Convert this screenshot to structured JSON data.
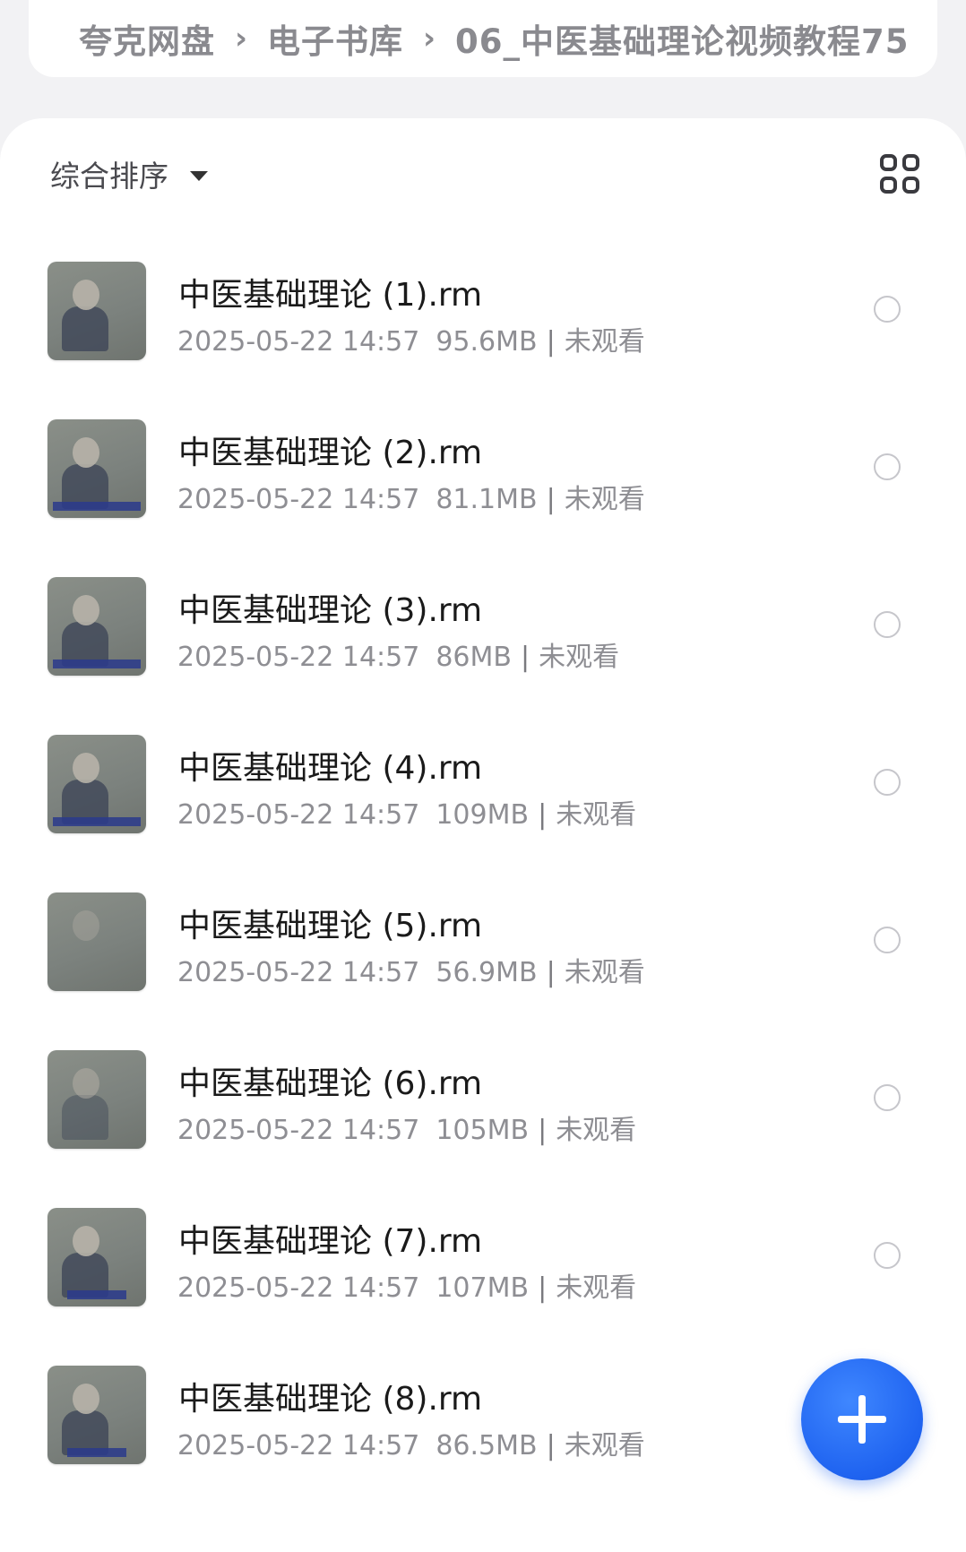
{
  "breadcrumb": {
    "items": [
      "夸克网盘",
      "电子书库",
      "06_中医基础理论视频教程75"
    ],
    "separator": "›"
  },
  "toolbar": {
    "sort_label": "综合排序",
    "sort_icon": "caret-down-icon",
    "view_toggle_icon": "grid-view-icon"
  },
  "files": [
    {
      "name": "中医基础理论 (1).rm",
      "date": "2025-05-22 14:57",
      "size": "95.6MB",
      "sep": "|",
      "status": "未观看"
    },
    {
      "name": "中医基础理论 (2).rm",
      "date": "2025-05-22 14:57",
      "size": "81.1MB",
      "sep": "|",
      "status": "未观看"
    },
    {
      "name": "中医基础理论 (3).rm",
      "date": "2025-05-22 14:57",
      "size": "86MB",
      "sep": "|",
      "status": "未观看"
    },
    {
      "name": "中医基础理论 (4).rm",
      "date": "2025-05-22 14:57",
      "size": "109MB",
      "sep": "|",
      "status": "未观看"
    },
    {
      "name": "中医基础理论 (5).rm",
      "date": "2025-05-22 14:57",
      "size": "56.9MB",
      "sep": "|",
      "status": "未观看"
    },
    {
      "name": "中医基础理论 (6).rm",
      "date": "2025-05-22 14:57",
      "size": "105MB",
      "sep": "|",
      "status": "未观看"
    },
    {
      "name": "中医基础理论 (7).rm",
      "date": "2025-05-22 14:57",
      "size": "107MB",
      "sep": "|",
      "status": "未观看"
    },
    {
      "name": "中医基础理论 (8).rm",
      "date": "2025-05-22 14:57",
      "size": "86.5MB",
      "sep": "|",
      "status": "未观看"
    }
  ],
  "fab": {
    "icon": "plus-icon",
    "color": "#1f63f0"
  },
  "colors": {
    "background": "#f2f2f4",
    "card": "#ffffff",
    "accent": "#1f63f0"
  }
}
